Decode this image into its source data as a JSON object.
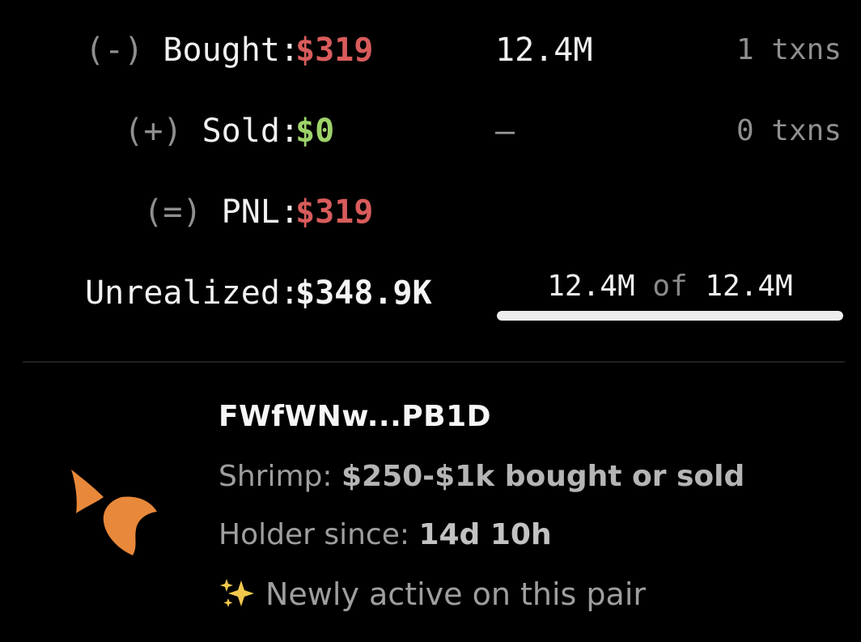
{
  "trade_summary": {
    "bought": {
      "sign": "(-)",
      "label": "Bought:",
      "value": "$319",
      "amount": "12.4M",
      "txns": "1 txns"
    },
    "sold": {
      "sign": "(+)",
      "label": "Sold:",
      "value": "$0",
      "amount": "–",
      "txns": "0 txns"
    },
    "pnl": {
      "sign": "(=)",
      "label": "PNL:",
      "value": "$319"
    },
    "unrealized": {
      "label": "Unrealized:",
      "value": "$348.9K",
      "holding_amount": "12.4M",
      "holding_of": "of",
      "holding_total": "12.4M",
      "holding_fraction": 1.0
    }
  },
  "wallet": {
    "address": "FWfWNw...PB1D",
    "icon": "shrimp-icon",
    "tier_label": "Shrimp:",
    "tier_value": "$250-$1k bought or sold",
    "holder_label": "Holder since:",
    "holder_value": "14d 10h",
    "newly_icon": "sparkles-icon",
    "newly_text": "Newly active on this pair"
  },
  "colors": {
    "background": "#000000",
    "negative": "#d95c5c",
    "positive": "#9ed36a",
    "shrimp": "#e8883a",
    "sparkle": "#f2c94c"
  }
}
